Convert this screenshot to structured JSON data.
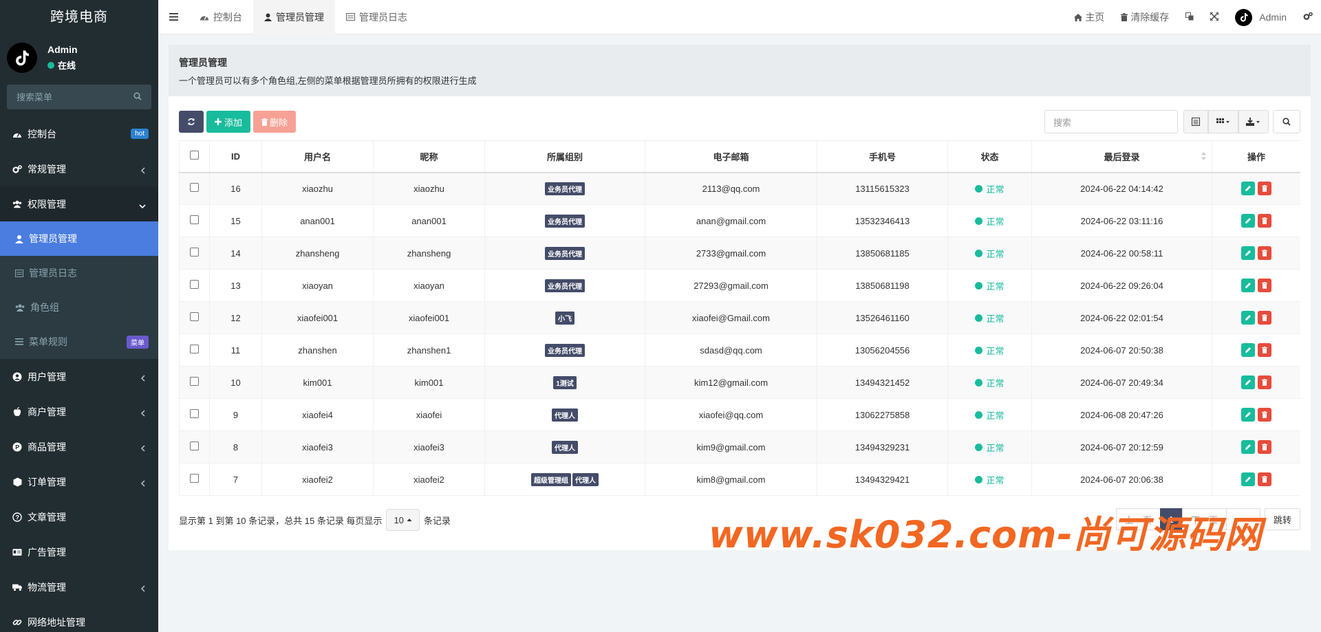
{
  "app": {
    "title": "跨境电商"
  },
  "user": {
    "name": "Admin",
    "status": "在线"
  },
  "sidebar": {
    "search_placeholder": "搜索菜单",
    "items": [
      {
        "label": "控制台",
        "icon": "dashboard-icon",
        "badge": "hot"
      },
      {
        "label": "常规管理",
        "icon": "cogs-icon"
      },
      {
        "label": "权限管理",
        "icon": "users-icon"
      },
      {
        "label": "用户管理",
        "icon": "user-circle-icon"
      },
      {
        "label": "商户管理",
        "icon": "apple-icon"
      },
      {
        "label": "商品管理",
        "icon": "product-icon"
      },
      {
        "label": "订单管理",
        "icon": "cube-icon"
      },
      {
        "label": "文章管理",
        "icon": "question-icon"
      },
      {
        "label": "广告管理",
        "icon": "id-card-icon"
      },
      {
        "label": "物流管理",
        "icon": "truck-icon"
      },
      {
        "label": "网络地址管理",
        "icon": "link-icon"
      }
    ],
    "submenu": [
      {
        "label": "管理员管理",
        "icon": "user-icon"
      },
      {
        "label": "管理员日志",
        "icon": "list-icon"
      },
      {
        "label": "角色组",
        "icon": "group-icon"
      },
      {
        "label": "菜单规则",
        "icon": "bars-icon",
        "badge": "菜单"
      }
    ]
  },
  "navbar": {
    "tabs": [
      {
        "label": "控制台",
        "icon": "dashboard-icon"
      },
      {
        "label": "管理员管理",
        "icon": "user-icon"
      },
      {
        "label": "管理员日志",
        "icon": "list-icon"
      }
    ],
    "home": "主页",
    "clear_cache": "清除缓存",
    "user": "Admin"
  },
  "page": {
    "title": "管理员管理",
    "description": "一个管理员可以有多个角色组,左侧的菜单根据管理员所拥有的权限进行生成"
  },
  "toolbar": {
    "add": "添加",
    "delete": "删除",
    "search_placeholder": "搜索"
  },
  "table": {
    "headers": [
      "ID",
      "用户名",
      "昵称",
      "所属组别",
      "电子邮箱",
      "手机号",
      "状态",
      "最后登录",
      "操作"
    ],
    "rows": [
      {
        "id": "16",
        "username": "xiaozhu",
        "nickname": "xiaozhu",
        "groups": [
          "业务员代理"
        ],
        "email": "2113@qq.com",
        "mobile": "13115615323",
        "status": "正常",
        "last_login": "2024-06-22 04:14:42"
      },
      {
        "id": "15",
        "username": "anan001",
        "nickname": "anan001",
        "groups": [
          "业务员代理"
        ],
        "email": "anan@gmail.com",
        "mobile": "13532346413",
        "status": "正常",
        "last_login": "2024-06-22 03:11:16"
      },
      {
        "id": "14",
        "username": "zhansheng",
        "nickname": "zhansheng",
        "groups": [
          "业务员代理"
        ],
        "email": "2733@gmail.com",
        "mobile": "13850681185",
        "status": "正常",
        "last_login": "2024-06-22 00:58:11"
      },
      {
        "id": "13",
        "username": "xiaoyan",
        "nickname": "xiaoyan",
        "groups": [
          "业务员代理"
        ],
        "email": "27293@gmail.com",
        "mobile": "13850681198",
        "status": "正常",
        "last_login": "2024-06-22 09:26:04"
      },
      {
        "id": "12",
        "username": "xiaofei001",
        "nickname": "xiaofei001",
        "groups": [
          "小飞"
        ],
        "email": "xiaofei@Gmail.com",
        "mobile": "13526461160",
        "status": "正常",
        "last_login": "2024-06-22 02:01:54"
      },
      {
        "id": "11",
        "username": "zhanshen",
        "nickname": "zhanshen1",
        "groups": [
          "业务员代理"
        ],
        "email": "sdasd@qq.com",
        "mobile": "13056204556",
        "status": "正常",
        "last_login": "2024-06-07 20:50:38"
      },
      {
        "id": "10",
        "username": "kim001",
        "nickname": "kim001",
        "groups": [
          "1测试"
        ],
        "email": "kim12@gmail.com",
        "mobile": "13494321452",
        "status": "正常",
        "last_login": "2024-06-07 20:49:34"
      },
      {
        "id": "9",
        "username": "xiaofei4",
        "nickname": "xiaofei",
        "groups": [
          "代理人"
        ],
        "email": "xiaofei@qq.com",
        "mobile": "13062275858",
        "status": "正常",
        "last_login": "2024-06-08 20:47:26"
      },
      {
        "id": "8",
        "username": "xiaofei3",
        "nickname": "xiaofei3",
        "groups": [
          "代理人"
        ],
        "email": "kim9@gmail.com",
        "mobile": "13494329231",
        "status": "正常",
        "last_login": "2024-06-07 20:12:59"
      },
      {
        "id": "7",
        "username": "xiaofei2",
        "nickname": "xiaofei2",
        "groups": [
          "超级管理组",
          "代理人"
        ],
        "email": "kim8@gmail.com",
        "mobile": "13494329421",
        "status": "正常",
        "last_login": "2024-06-07 20:06:38"
      }
    ]
  },
  "pagination": {
    "summary": "显示第 1 到第 10 条记录，总共 15 条记录 每页显示",
    "page_size": "10",
    "suffix": "条记录",
    "prev": "上一页",
    "current": "1",
    "next": "下一页",
    "jump": "跳转"
  },
  "watermark": "www.sk032.com-尚可源码网",
  "colors": {
    "sidebar_bg": "#222d32",
    "active": "#4a7ddf",
    "primary_dark": "#444c69",
    "success": "#18bc9c",
    "danger": "#e74c3c",
    "watermark": "#f26722"
  }
}
